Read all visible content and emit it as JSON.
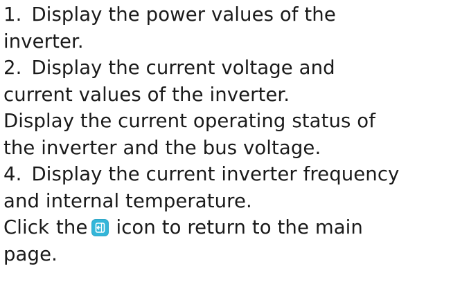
{
  "document": {
    "item1": {
      "number": "1.",
      "line1": "Display the power values of the",
      "line2": "inverter."
    },
    "item2": {
      "number": "2.",
      "line1": "Display the current voltage and",
      "line2": "current values of the inverter."
    },
    "item3": {
      "line1": "Display the current operating status of",
      "line2": "the inverter and the bus voltage."
    },
    "item4": {
      "number": "4.",
      "line1": "Display the current inverter frequency",
      "line2": "and internal temperature."
    },
    "return_note": {
      "prefix": "Click",
      "word_the": "the",
      "icon": "return-icon",
      "suffix": "icon to return to the main",
      "line2": "page."
    }
  }
}
